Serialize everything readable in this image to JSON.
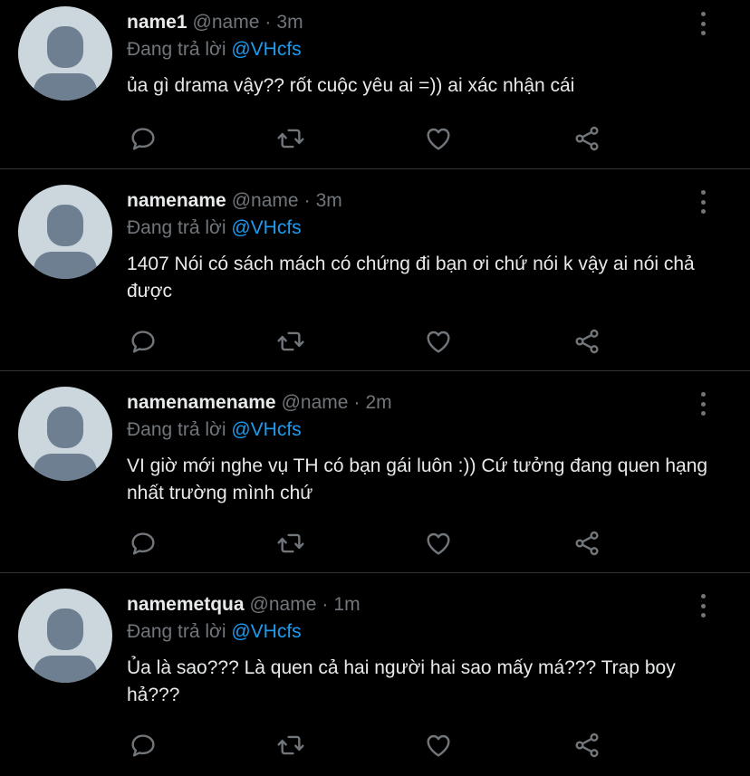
{
  "colors": {
    "background": "#000000",
    "text": "#e7e9ea",
    "secondary": "#71767b",
    "mention": "#1d9bf0",
    "divider": "#2f3336",
    "avatar_bg": "#ccd6dd",
    "avatar_fg": "#6e7f91"
  },
  "icons": [
    "reply-icon",
    "retweet-icon",
    "like-icon",
    "share-icon",
    "more-icon",
    "default-avatar-icon"
  ],
  "replies": [
    {
      "display_name": "name1",
      "handle": "@name",
      "separator": "·",
      "time": "3m",
      "replying_prefix": "Đang trả lời",
      "replying_to": "@VHcfs",
      "text": "ủa gì drama vậy?? rốt cuộc yêu ai =)) ai xác nhận cái"
    },
    {
      "display_name": "namename",
      "handle": "@name",
      "separator": "·",
      "time": "3m",
      "replying_prefix": "Đang trả lời",
      "replying_to": "@VHcfs",
      "text": "1407 Nói có sách mách có chứng đi bạn ơi chứ nói k vậy ai nói chả được"
    },
    {
      "display_name": "namenamename",
      "handle": "@name",
      "separator": "·",
      "time": "2m",
      "replying_prefix": "Đang trả lời",
      "replying_to": "@VHcfs",
      "text": "VI giờ mới nghe vụ TH có bạn gái luôn :)) Cứ tưởng đang quen hạng nhất trường mình chứ"
    },
    {
      "display_name": "namemetqua",
      "handle": "@name",
      "separator": "·",
      "time": "1m",
      "replying_prefix": "Đang trả lời",
      "replying_to": "@VHcfs",
      "text": "Ủa là sao??? Là quen cả hai người hai sao mấy má??? Trap boy hả???"
    }
  ]
}
